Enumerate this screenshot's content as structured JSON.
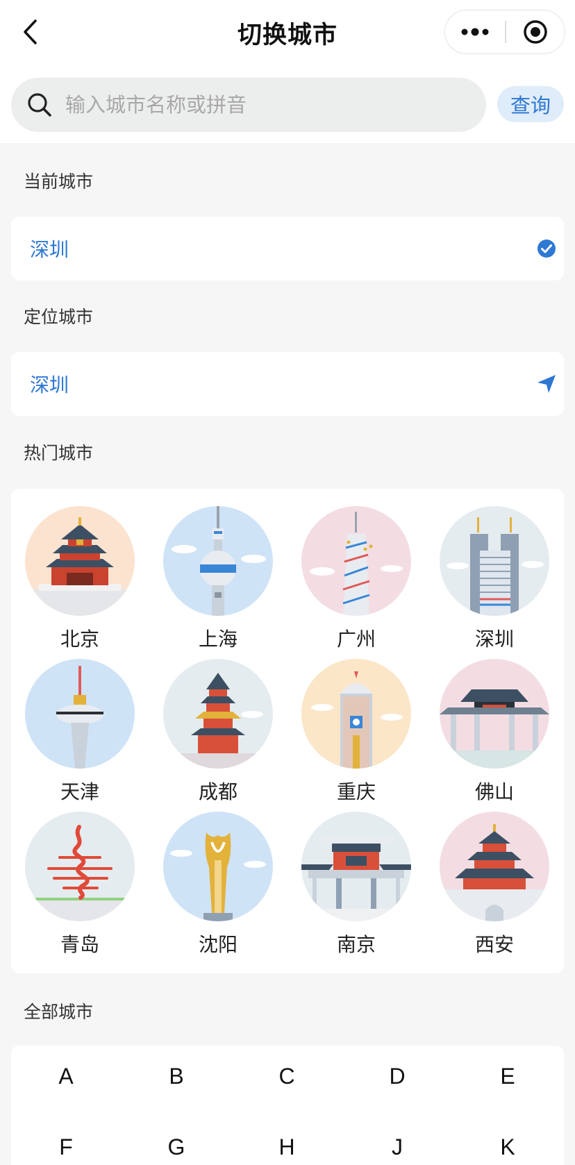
{
  "header": {
    "title": "切换城市",
    "back_icon": "chevron-left-icon",
    "more_icon": "more-dots-icon",
    "close_icon": "target-circle-icon"
  },
  "search": {
    "placeholder": "输入城市名称或拼音",
    "value": "",
    "button_label": "查询"
  },
  "current_city": {
    "label": "当前城市",
    "name": "深圳",
    "icon": "check-circle-icon"
  },
  "located_city": {
    "label": "定位城市",
    "name": "深圳",
    "icon": "location-arrow-icon"
  },
  "hot_cities": {
    "label": "热门城市",
    "items": [
      {
        "name": "北京",
        "bg": "#fbe3cf"
      },
      {
        "name": "上海",
        "bg": "#cfe3f7"
      },
      {
        "name": "广州",
        "bg": "#f3dde3"
      },
      {
        "name": "深圳",
        "bg": "#e5ecef"
      },
      {
        "name": "天津",
        "bg": "#cfe3f7"
      },
      {
        "name": "成都",
        "bg": "#e5ecef"
      },
      {
        "name": "重庆",
        "bg": "#fbe6c8"
      },
      {
        "name": "佛山",
        "bg": "#f3dde3"
      },
      {
        "name": "青岛",
        "bg": "#e5ecef"
      },
      {
        "name": "沈阳",
        "bg": "#cfe3f7"
      },
      {
        "name": "南京",
        "bg": "#e5ecef"
      },
      {
        "name": "西安",
        "bg": "#f3dde3"
      }
    ]
  },
  "all_cities": {
    "label": "全部城市",
    "letters": [
      "A",
      "B",
      "C",
      "D",
      "E",
      "F",
      "G",
      "H",
      "J",
      "K"
    ]
  },
  "colors": {
    "accent": "#2e78d4",
    "page_bg": "#f6f6f6"
  }
}
